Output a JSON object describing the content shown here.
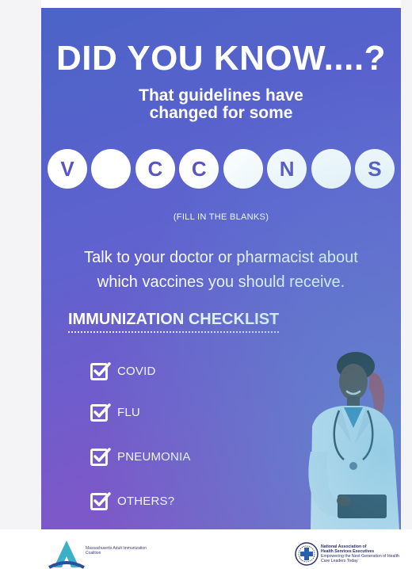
{
  "poster": {
    "headline": "DID YOU KNOW....?",
    "subhead_line1": "That guidelines have",
    "subhead_line2": "changed for some",
    "letters": [
      "V",
      "",
      "C",
      "C",
      "",
      "N",
      "",
      "S"
    ],
    "fill_in": "(FILL IN THE BLANKS)",
    "talk_line1": "Talk to your doctor or pharmacist about",
    "talk_line2": "which vaccines you should receive.",
    "checklist_title": "IMMUNIZATION CHECKLIST",
    "checklist": [
      "COVID",
      "FLU",
      "PNEUMONIA",
      "OTHERS?"
    ]
  },
  "footer": {
    "left_logo_text": "Massachusetts Adult Immunization Coalition",
    "right_logo_text_line1": "National Association of",
    "right_logo_text_line2": "Health Services Executives",
    "right_logo_text_line3": "Empowering the Next Generation of Health Care Leaders Today"
  },
  "colors": {
    "gradient_start": "#4b63c7",
    "gradient_end": "#8555c6",
    "letter_text": "#5a55c2"
  }
}
